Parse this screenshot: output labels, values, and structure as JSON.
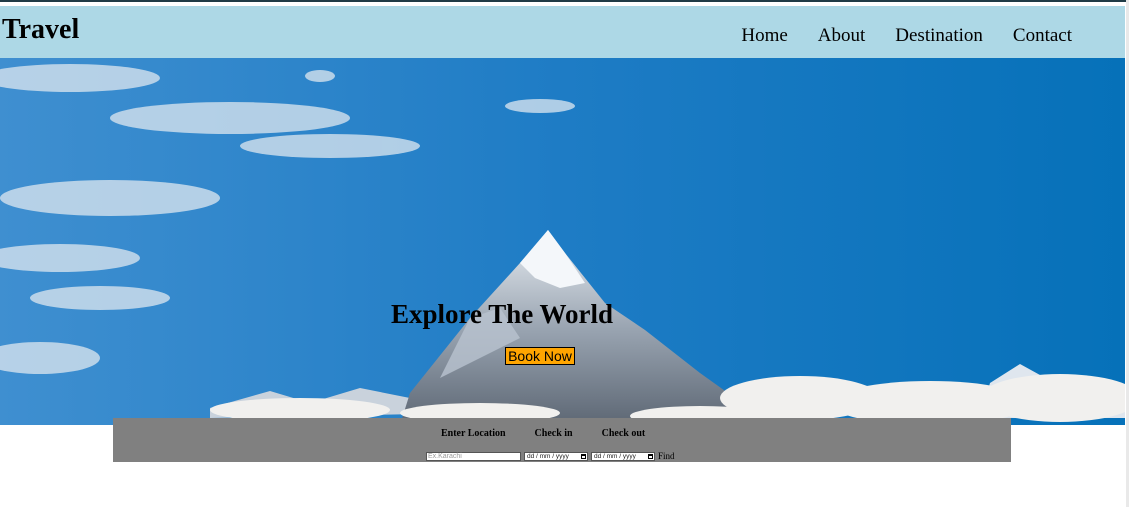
{
  "header": {
    "brand": "Travel",
    "nav": [
      "Home",
      "About",
      "Destination",
      "Contact"
    ]
  },
  "hero": {
    "title": "Explore The World",
    "button_label": "Book Now",
    "background_image": "snow-capped-mountain-peak-icon"
  },
  "search": {
    "location_label": "Enter Location",
    "checkin_label": "Check in",
    "checkout_label": "Check out",
    "location_placeholder": "Ex.Karachi",
    "checkin_value": "dd / mm / yyyy",
    "checkout_value": "dd / mm / yyyy",
    "find_label": "Find"
  },
  "colors": {
    "navbar": "#add8e6",
    "button": "#ffa500",
    "search_bar": "#808080"
  }
}
